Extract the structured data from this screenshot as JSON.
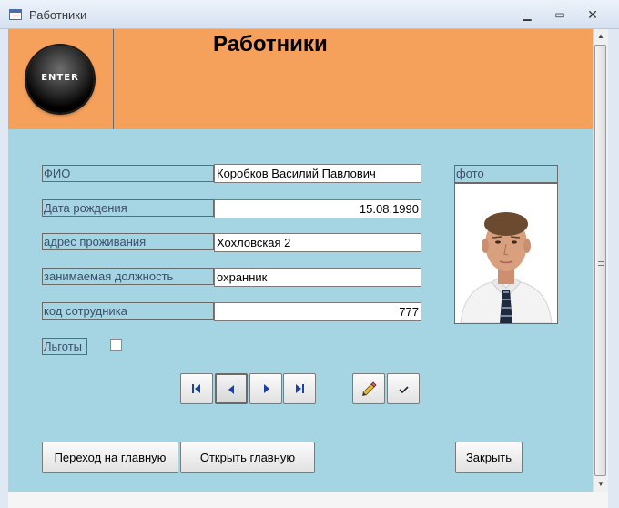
{
  "window": {
    "title": "Работники"
  },
  "header": {
    "logo_text": "ENTER",
    "title": "Работники"
  },
  "fields": {
    "fio": {
      "label": "ФИО",
      "value": "Коробков Василий Павлович"
    },
    "birth": {
      "label": "Дата  рождения",
      "value": "15.08.1990"
    },
    "address": {
      "label": "адрес  проживания",
      "value": "Хохловская 2"
    },
    "position": {
      "label": "занимаемая должность",
      "value": "охранник"
    },
    "code": {
      "label": "код сотрудника",
      "value": "777"
    },
    "lgoty": {
      "label": "Льготы",
      "checked": false
    }
  },
  "photo": {
    "label": "фото"
  },
  "buttons": {
    "goto_main": "Переход на главную",
    "open_main": "Открыть главную",
    "close": "Закрыть"
  },
  "colors": {
    "header": "#f5a05b",
    "form_bg": "#a5d5e3"
  }
}
